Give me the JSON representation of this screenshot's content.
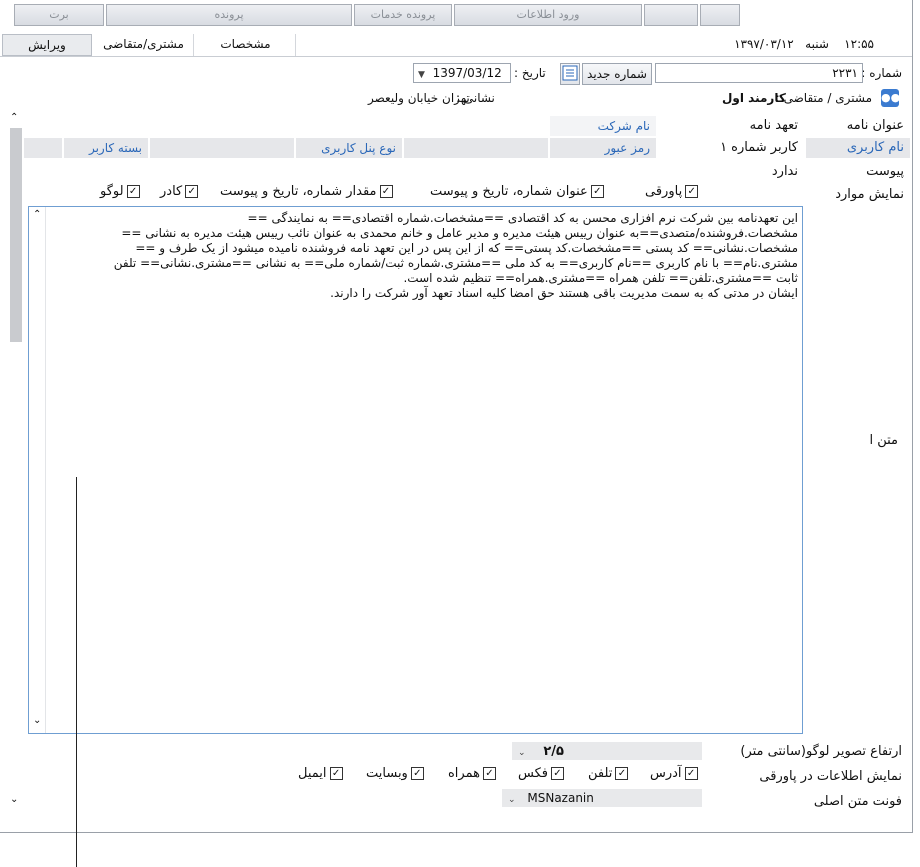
{
  "top_tabs": [
    "برت",
    "پرونده",
    "پرونده خدمات",
    "ورود اطلاعات",
    "",
    ""
  ],
  "tabs": {
    "edit": "ویرایش",
    "customer": "مشتری/متقاضی",
    "specs": "مشخصات"
  },
  "header": {
    "time": "۱۲:۵۵",
    "day": "شنبه",
    "date": "۱۳۹۷/۰۳/۱۲"
  },
  "form": {
    "number_label": "شماره :",
    "number_value": "۲۲۳۱",
    "new_number_button": "شماره جدید",
    "date_label": "تاریخ :",
    "date_value": "1397/03/12",
    "customer_label": "مشتری / متقاضی :",
    "customer_value": "کارمند اول",
    "address_label": "نشانی :",
    "address_value": "تهران خیابان ولیعصر"
  },
  "grid": {
    "title_label": "عنوان نامه",
    "title_value": "تعهد نامه",
    "company_placeholder": "نام شرکت",
    "username_label": "نام کاربری",
    "username_value": "کاربر شماره ۱",
    "password_label": "رمز عبور",
    "panel_type_label": "نوع پنل کاربری",
    "user_package_label": "بسته کاربر",
    "attachment_label": "پیوست",
    "attachment_value": "ندارد",
    "show_items_label": "نمایش موارد"
  },
  "show_items": [
    {
      "label": "پاورقی",
      "checked": true
    },
    {
      "label": "عنوان شماره، تاریخ و پیوست",
      "checked": true
    },
    {
      "label": "مقدار شماره، تاریخ و پیوست",
      "checked": true
    },
    {
      "label": "کادر",
      "checked": true
    },
    {
      "label": "لوگو",
      "checked": true
    }
  ],
  "editor": {
    "label": "متن ا",
    "lines": [
      "این تعهدنامه بین شرکت نرم افزاری محسن به کد اقتصادی ==مشخصات.شماره اقتصادی== به نمایندگی ==",
      "مشخصات.فروشنده/متصدی==به عنوان رییس هیئت مدیره و مدیر عامل و خانم محمدی به عنوان نائب رییس هیئت مدیره به نشانی ==",
      "مشخصات.نشانی== کد پستی ==مشخصات.کد پستی== که از این پس در این تعهد نامه فروشنده نامیده میشود از یک طرف و ==",
      "مشتری.نام==   با نام کاربری ==نام کاربری== به کد ملی ==مشتری.شماره ثبت/شماره ملی== به نشانی ==مشتری.نشانی== تلفن",
      "ثابت ==مشتری.تلفن== تلفن همراه ==مشتری.همراه== تنظیم شده است.",
      "ایشان در مدتی که به سمت مدیریت باقی هستند حق امضا کلیه اسناد تعهد آور شرکت را دارند."
    ]
  },
  "bottom": {
    "logo_height_label": "ارتفاع تصویر لوگو(سانتی متر)",
    "logo_height_value": "۲/۵",
    "footer_info_label": "نمایش اطلاعات در پاورقی",
    "main_font_label": "فونت متن اصلی",
    "main_font_value": "MSNazanin"
  },
  "footer_items": [
    {
      "label": "آدرس",
      "checked": true
    },
    {
      "label": "تلفن",
      "checked": true
    },
    {
      "label": "فکس",
      "checked": true
    },
    {
      "label": "همراه",
      "checked": true
    },
    {
      "label": "وبسایت",
      "checked": true
    },
    {
      "label": "ایمیل",
      "checked": true
    }
  ],
  "colors": {
    "link_blue": "#2a67b8",
    "editor_border": "#6f9ed2",
    "accent_icon": "#3b7bd0"
  }
}
